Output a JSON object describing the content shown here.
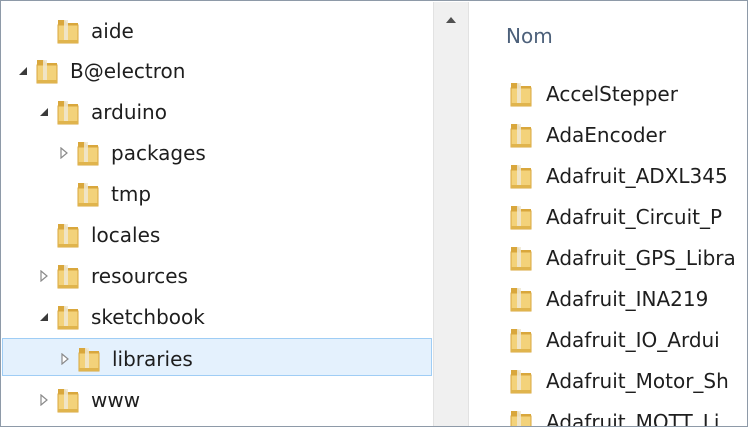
{
  "navigation_tree": {
    "items": [
      {
        "label": "aide",
        "depth": 1,
        "toggle": "none"
      },
      {
        "label": "B@electron",
        "depth": 0,
        "toggle": "expanded"
      },
      {
        "label": "arduino",
        "depth": 1,
        "toggle": "expanded"
      },
      {
        "label": "packages",
        "depth": 2,
        "toggle": "collapsed"
      },
      {
        "label": "tmp",
        "depth": 2,
        "toggle": "none"
      },
      {
        "label": "locales",
        "depth": 1,
        "toggle": "none"
      },
      {
        "label": "resources",
        "depth": 1,
        "toggle": "collapsed"
      },
      {
        "label": "sketchbook",
        "depth": 1,
        "toggle": "expanded"
      },
      {
        "label": "libraries",
        "depth": 2,
        "toggle": "collapsed",
        "selected": true
      },
      {
        "label": "www",
        "depth": 1,
        "toggle": "collapsed"
      }
    ]
  },
  "content": {
    "column_header": "Nom",
    "items": [
      "AccelStepper",
      "AdaEncoder",
      "Adafruit_ADXL345",
      "Adafruit_Circuit_P",
      "Adafruit_GPS_Libra",
      "Adafruit_INA219",
      "Adafruit_IO_Ardui",
      "Adafruit_Motor_Sh",
      "Adafruit_MQTT_Li"
    ]
  },
  "colors": {
    "selection_background": "#e4f1fd",
    "selection_border": "#9fcdf5",
    "header_text": "#4c607a",
    "folder_body": "#f3d27a",
    "folder_dark": "#d9a73c"
  }
}
